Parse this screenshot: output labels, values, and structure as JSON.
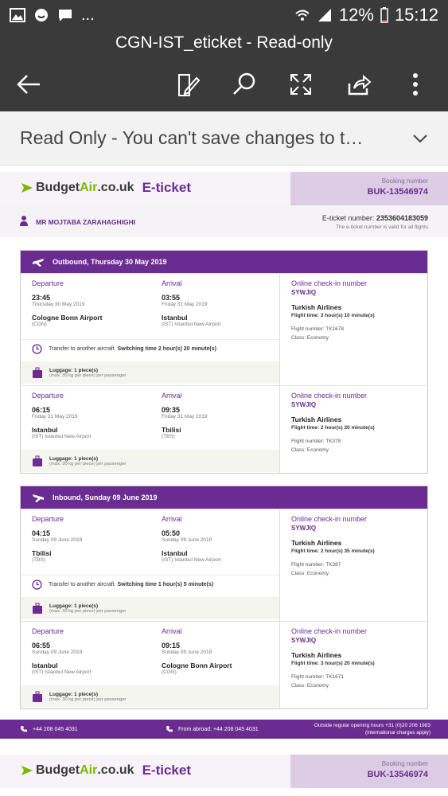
{
  "status": {
    "battery": "12%",
    "time": "15:12",
    "dots": "..."
  },
  "app": {
    "title": "CGN-IST_eticket - Read-only"
  },
  "banner": {
    "text": "Read Only - You can't save changes to t…"
  },
  "doc": {
    "brand1": "Budget",
    "brand2": "Air",
    "brand3": ".co.uk",
    "eticket": "E-ticket",
    "booking_label": "Booking number",
    "booking_value": "BUK-13546974",
    "passenger": "MR MOJTABA ZARAHAGHIGHI",
    "eticket_label": "E-ticket number:",
    "eticket_number": "2353604183059",
    "eticket_note": "The e-ticket number is valid for all flights",
    "outbound": {
      "title": "Outbound, Thursday 30 May 2019",
      "legs": [
        {
          "dep_label": "Departure",
          "arr_label": "Arrival",
          "dep_time": "23:45",
          "dep_date": "Thursday 30 May 2019",
          "dep_airport": "Cologne Bonn Airport",
          "dep_code": "(CGN)",
          "arr_time": "03:55",
          "arr_date": "Friday 31 May 2019",
          "arr_airport": "Istanbul",
          "arr_code": "(IST) Istanbul New Airport",
          "lug1": "Luggage: 1 piece(s)",
          "lug2": "(max. 30 kg per piece) per passenger",
          "chk_label": "Online check-in number",
          "chk_value": "SYWJIQ",
          "airline": "Turkish Airlines",
          "flight_time": "Flight time: 3 hour(s) 10 minute(s)",
          "flight_number": "Flight number: TK1678",
          "class": "Class: Economy"
        },
        {
          "dep_label": "Departure",
          "arr_label": "Arrival",
          "dep_time": "06:15",
          "dep_date": "Friday 31 May 2019",
          "dep_airport": "Istanbul",
          "dep_code": "(IST) Istanbul New Airport",
          "arr_time": "09:35",
          "arr_date": "Friday 31 May 2019",
          "arr_airport": "Tbilisi",
          "arr_code": "(TBS)",
          "lug1": "Luggage: 1 piece(s)",
          "lug2": "(max. 30 kg per piece) per passenger",
          "chk_label": "Online check-in number",
          "chk_value": "SYWJIQ",
          "airline": "Turkish Airlines",
          "flight_time": "Flight time: 2 hour(s) 20 minute(s)",
          "flight_number": "Flight number: TK378",
          "class": "Class: Economy"
        }
      ],
      "transfer_prefix": "Transfer to another aircraft.",
      "transfer_bold": "Switching time 2 hour(s) 20 minute(s)"
    },
    "inbound": {
      "title": "Inbound, Sunday 09 June 2019",
      "legs": [
        {
          "dep_label": "Departure",
          "arr_label": "Arrival",
          "dep_time": "04:15",
          "dep_date": "Sunday 09 June 2019",
          "dep_airport": "Tbilisi",
          "dep_code": "(TBS)",
          "arr_time": "05:50",
          "arr_date": "Sunday 09 June 2019",
          "arr_airport": "Istanbul",
          "arr_code": "(IST) Istanbul New Airport",
          "lug1": "Luggage: 1 piece(s)",
          "lug2": "(max. 30 kg per piece) per passenger",
          "chk_label": "Online check-in number",
          "chk_value": "SYWJIQ",
          "airline": "Turkish Airlines",
          "flight_time": "Flight time: 2 hour(s) 35 minute(s)",
          "flight_number": "Flight number: TK387",
          "class": "Class: Economy"
        },
        {
          "dep_label": "Departure",
          "arr_label": "Arrival",
          "dep_time": "06:55",
          "dep_date": "Sunday 09 June 2019",
          "dep_airport": "Istanbul",
          "dep_code": "(IST) Istanbul New Airport",
          "arr_time": "09:15",
          "arr_date": "Sunday 09 June 2019",
          "arr_airport": "Cologne Bonn Airport",
          "arr_code": "(CGN)",
          "lug1": "Luggage: 1 piece(s)",
          "lug2": "(max. 30 kg per piece) per passenger",
          "chk_label": "Online check-in number",
          "chk_value": "SYWJIQ",
          "airline": "Turkish Airlines",
          "flight_time": "Flight time: 3 hour(s) 20 minute(s)",
          "flight_number": "Flight number: TK1671",
          "class": "Class: Economy"
        }
      ],
      "transfer_prefix": "Transfer to another aircraft.",
      "transfer_bold": "Switching time 1 hour(s) 5 minute(s)"
    },
    "footer": {
      "phone": "+44 208 045 4031",
      "abroad": "From abroad: +44 208 045 4031",
      "hours": "Outside regular opening hours +31 (0)20 206 1983 (international charges apply)"
    }
  },
  "colors": {
    "purple": "#6b2c91",
    "green": "#7ab800",
    "appbar": "#3a3a3a"
  }
}
